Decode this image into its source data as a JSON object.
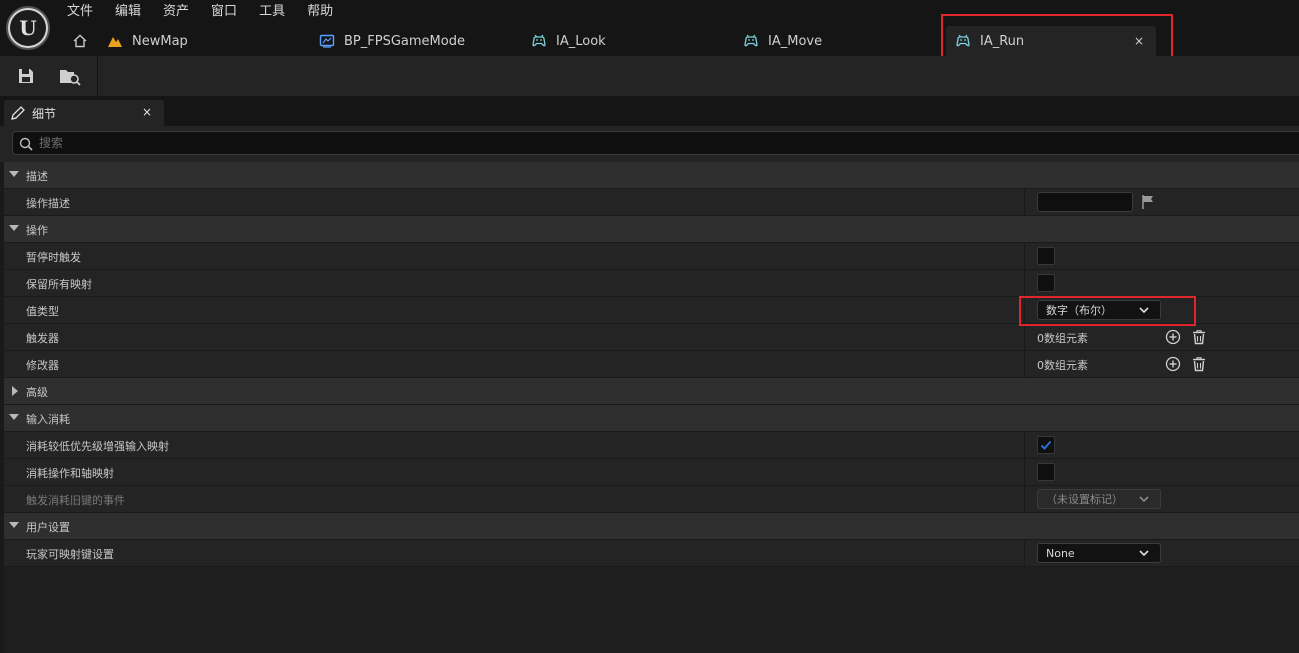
{
  "menu": [
    "文件",
    "编辑",
    "资产",
    "窗口",
    "工具",
    "帮助"
  ],
  "doc_tabs": [
    {
      "label": "NewMap",
      "icon": "level-icon",
      "active": false
    },
    {
      "label": "BP_FPSGameMode",
      "icon": "blueprint-icon",
      "active": false
    },
    {
      "label": "IA_Look",
      "icon": "input-action-icon",
      "active": false
    },
    {
      "label": "IA_Move",
      "icon": "input-action-icon",
      "active": false
    },
    {
      "label": "IA_Run",
      "icon": "input-action-icon",
      "active": true
    }
  ],
  "tab_close": "×",
  "toolbar": {
    "save": "save-icon",
    "browse": "browse-asset-icon"
  },
  "details": {
    "tab_label": "细节",
    "search_placeholder": "搜索"
  },
  "categories": {
    "description": {
      "label": "描述",
      "action_description": {
        "label": "操作描述",
        "value": ""
      }
    },
    "action": {
      "label": "操作",
      "trigger_when_paused": {
        "label": "暂停时触发",
        "checked": false
      },
      "reserve_all_mappings": {
        "label": "保留所有映射",
        "checked": false
      },
      "value_type": {
        "label": "值类型",
        "value": "数字（布尔）"
      },
      "triggers": {
        "label": "触发器",
        "value": "0数组元素"
      },
      "modifiers": {
        "label": "修改器",
        "value": "0数组元素"
      }
    },
    "advanced": {
      "label": "高级"
    },
    "input_consumption": {
      "label": "输入消耗",
      "consume_lower_priority": {
        "label": "消耗较低优先级增强输入映射",
        "checked": true
      },
      "consume_action_axis": {
        "label": "消耗操作和轴映射",
        "checked": false
      },
      "trigger_events_consume": {
        "label": "触发消耗旧键的事件",
        "value": "（未设置标记）"
      }
    },
    "user_settings": {
      "label": "用户设置",
      "player_mappable_key": {
        "label": "玩家可映射键设置",
        "value": "None"
      }
    }
  },
  "colors": {
    "accent": "#2a6fd6",
    "highlight": "#e0252b",
    "level_icon": "#e8a21c",
    "input_icon": "#7dd3e0",
    "blueprint_icon": "#5aa0ff"
  }
}
